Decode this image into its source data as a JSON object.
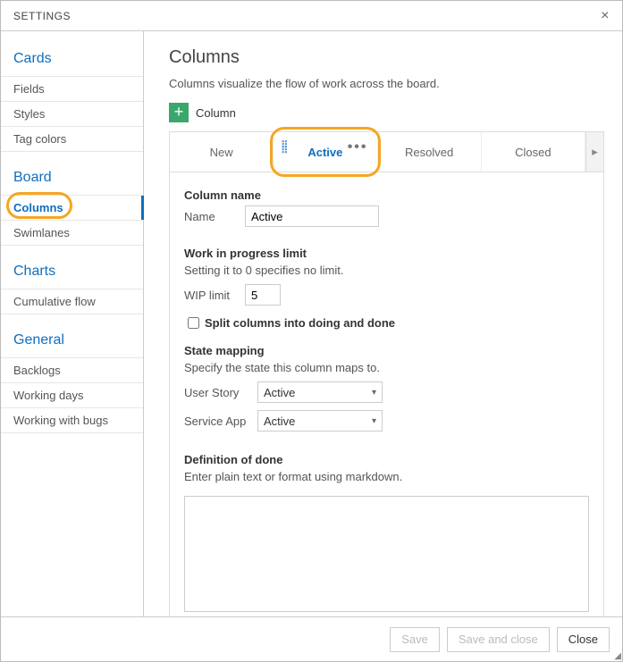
{
  "titlebar": {
    "title": "SETTINGS"
  },
  "sidebar": {
    "groups": [
      {
        "header": "Cards",
        "items": [
          {
            "label": "Fields"
          },
          {
            "label": "Styles"
          },
          {
            "label": "Tag colors"
          }
        ]
      },
      {
        "header": "Board",
        "items": [
          {
            "label": "Columns",
            "selected": true
          },
          {
            "label": "Swimlanes"
          }
        ]
      },
      {
        "header": "Charts",
        "items": [
          {
            "label": "Cumulative flow"
          }
        ]
      },
      {
        "header": "General",
        "items": [
          {
            "label": "Backlogs"
          },
          {
            "label": "Working days"
          },
          {
            "label": "Working with bugs"
          }
        ]
      }
    ]
  },
  "main": {
    "title": "Columns",
    "description": "Columns visualize the flow of work across the board.",
    "add_button_label": "Column",
    "tabs": [
      {
        "label": "New"
      },
      {
        "label": "Active",
        "active": true
      },
      {
        "label": "Resolved"
      },
      {
        "label": "Closed"
      }
    ],
    "column_name_section": "Column name",
    "name_label": "Name",
    "name_value": "Active",
    "wip_section": "Work in progress limit",
    "wip_sub": "Setting it to 0 specifies no limit.",
    "wip_label": "WIP limit",
    "wip_value": "5",
    "split_label": "Split columns into doing and done",
    "split_checked": false,
    "state_mapping_section": "State mapping",
    "state_mapping_sub": "Specify the state this column maps to.",
    "mappings": [
      {
        "label": "User Story",
        "value": "Active"
      },
      {
        "label": "Service App",
        "value": "Active"
      }
    ],
    "dod_section": "Definition of done",
    "dod_sub": "Enter plain text or format using markdown.",
    "dod_value": ""
  },
  "footer": {
    "save": "Save",
    "save_and_close": "Save and close",
    "close": "Close"
  }
}
